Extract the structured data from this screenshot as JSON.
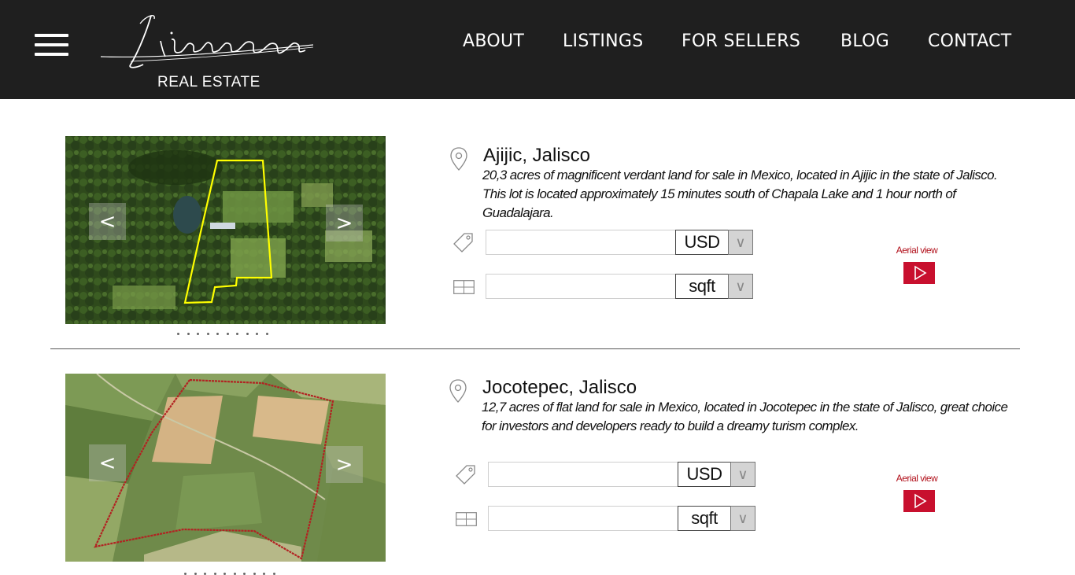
{
  "header": {
    "logo_text": "Lizarraga",
    "logo_subtitle": "REAL ESTATE",
    "nav": [
      "ABOUT",
      "LISTINGS",
      "FOR SELLERS",
      "BLOG",
      "CONTACT"
    ]
  },
  "listings": [
    {
      "location": "Ajijic, Jalisco",
      "description": "20,3 acres of magnificent verdant land for sale in Mexico, located in Ajijic in the state of Jalisco. This lot is located approximately 15 minutes south of Chapala Lake and 1 hour north of Guadalajara.",
      "price_value": "",
      "price_unit": "USD",
      "area_value": "",
      "area_unit": "sqft",
      "aerial_label": "Aerial view",
      "prev_label": "<",
      "next_label": ">",
      "image_outline_color": "#ffff00"
    },
    {
      "location": "Jocotepec, Jalisco",
      "description": "12,7 acres of flat land for sale in Mexico, located in Jocotepec in the state of Jalisco, great choice for investors and developers ready to build a dreamy turism complex.",
      "price_value": "",
      "price_unit": "USD",
      "area_value": "",
      "area_unit": "sqft",
      "aerial_label": "Aerial view",
      "prev_label": "<",
      "next_label": ">",
      "image_outline_color": "#c0392b"
    }
  ],
  "colors": {
    "header_bg": "#1f1f1f",
    "accent_red": "#c8102e"
  },
  "icons": {
    "menu": "hamburger-icon",
    "location": "map-pin-icon",
    "price": "price-tag-icon",
    "area": "area-grid-icon",
    "play": "play-icon",
    "dropdown": "chevron-down-icon"
  }
}
